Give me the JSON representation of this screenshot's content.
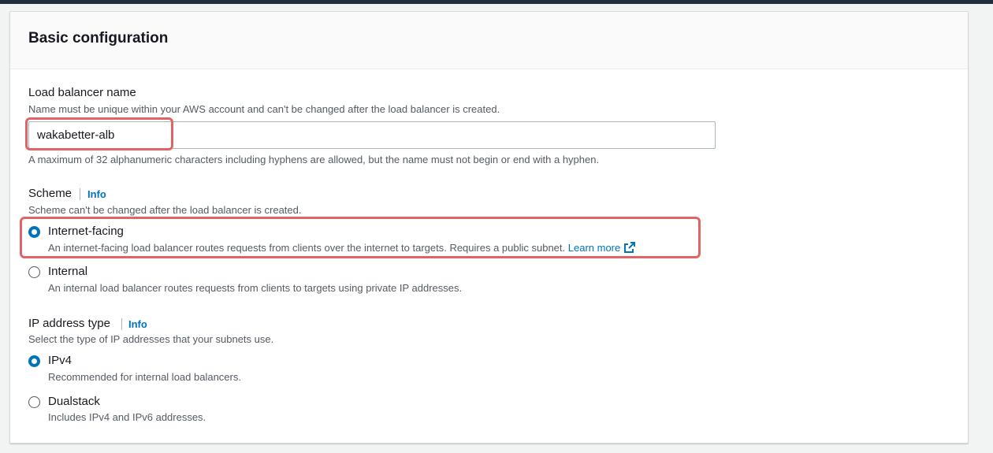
{
  "section": {
    "title": "Basic configuration"
  },
  "load_balancer_name": {
    "label": "Load balancer name",
    "description": "Name must be unique within your AWS account and can't be changed after the load balancer is created.",
    "value": "wakabetter-alb",
    "constraint": "A maximum of 32 alphanumeric characters including hyphens are allowed, but the name must not begin or end with a hyphen."
  },
  "scheme": {
    "label": "Scheme",
    "info": "Info",
    "description": "Scheme can't be changed after the load balancer is created.",
    "options": [
      {
        "label": "Internet-facing",
        "description": "An internet-facing load balancer routes requests from clients over the internet to targets. Requires a public subnet.",
        "link": "Learn more",
        "selected": true
      },
      {
        "label": "Internal",
        "description": "An internal load balancer routes requests from clients to targets using private IP addresses.",
        "selected": false
      }
    ]
  },
  "ip_address_type": {
    "label": "IP address type",
    "info": "Info",
    "description": "Select the type of IP addresses that your subnets use.",
    "options": [
      {
        "label": "IPv4",
        "description": "Recommended for internal load balancers.",
        "selected": true
      },
      {
        "label": "Dualstack",
        "description": "Includes IPv4 and IPv6 addresses.",
        "selected": false
      }
    ]
  },
  "colors": {
    "accent": "#0073bb",
    "highlight": "#e06366",
    "header_bar": "#232f3e"
  },
  "icons": {
    "learn_more": "external-link-icon"
  }
}
